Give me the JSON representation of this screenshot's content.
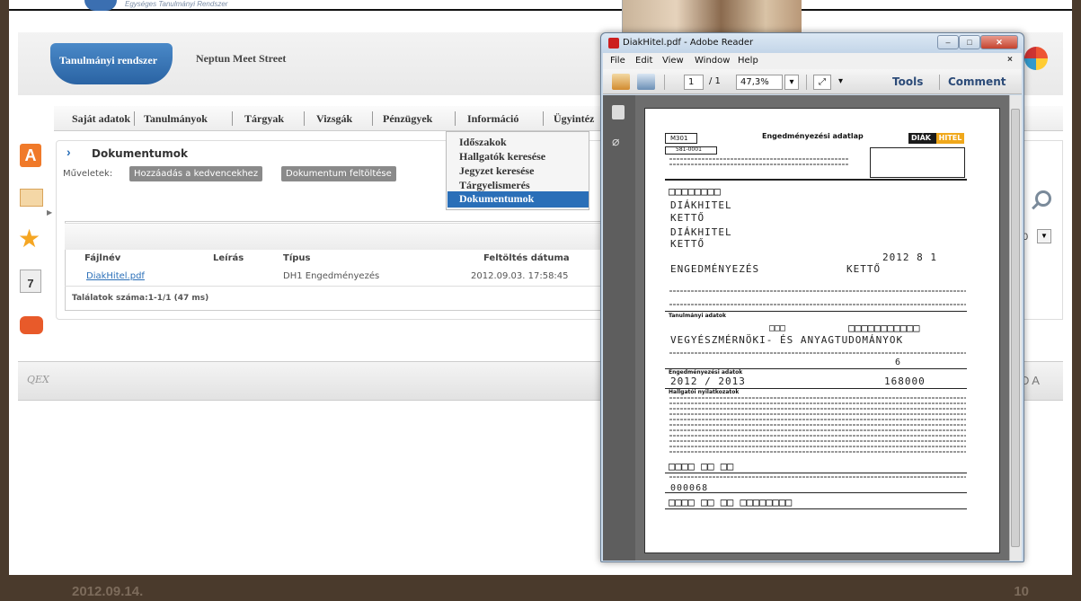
{
  "slide": {
    "date": "2012.09.14.",
    "page_number": "10"
  },
  "branding": {
    "subtitle": "Egységes Tanulmányi Rendszer"
  },
  "header": {
    "active_tab": "Tanulmányi rendszer",
    "other_tab": "Neptun Meet Street"
  },
  "menu": {
    "items": [
      "Saját adatok",
      "Tanulmányok",
      "Tárgyak",
      "Vizsgák",
      "Pénzügyek",
      "Információ",
      "Ügyintéz"
    ],
    "dropdown": [
      "Időszakok",
      "Hallgatók keresése",
      "Jegyzet keresése",
      "Tárgyelismerés",
      "Dokumentumok"
    ]
  },
  "documents": {
    "title": "Dokumentumok",
    "actions_label": "Műveletek:",
    "btn_favorite": "Hozzáadás a kedvencekhez",
    "btn_upload": "Dokumentum feltöltése",
    "columns": [
      "Fájlnév",
      "Leírás",
      "Típus",
      "Feltöltés dátuma"
    ],
    "rows": [
      {
        "file": "DiakHitel.pdf",
        "desc": "",
        "type": "DH1 Engedményezés",
        "date": "2012.09.03. 17:58:45"
      }
    ],
    "results": "Találatok száma:1-1/1 (47 ms)"
  },
  "side": {
    "pager_value": "0",
    "footer_text": "D A"
  },
  "reader": {
    "title": "DiakHitel.pdf - Adobe Reader",
    "menu": [
      "File",
      "Edit",
      "View",
      "Window",
      "Help"
    ],
    "page_current": "1",
    "page_total": "/ 1",
    "zoom": "47,3%",
    "tools": "Tools",
    "comment": "Comment"
  },
  "pdf": {
    "title": "Engedményezési adatlap",
    "logo_left": "DIÁK",
    "logo_right": "HITEL",
    "form_code": "M301",
    "code_line": "581-0001",
    "name1": "DIÁKHITEL",
    "name2": "KETTŐ",
    "name3": "DIÁKHITEL",
    "name4": "KETTŐ",
    "date_written": "2012   8   1",
    "engedmenyezes": "ENGEDMÉNYEZÉS",
    "ketto2": "KETTŐ",
    "section_student": "Tanulmányi adatok",
    "faculty": "VEGYÉSZMÉRNÖKI- ÉS ANYAGTUDOMÁNYOK",
    "section_amount": "Engedményezési adatok",
    "year": "2012 / 2013",
    "amount": "168000",
    "semester_num": "6",
    "section_statement": "Hallgatói nyilatkozatok",
    "code_bottom": "000068"
  },
  "footer_logo": "QEX"
}
